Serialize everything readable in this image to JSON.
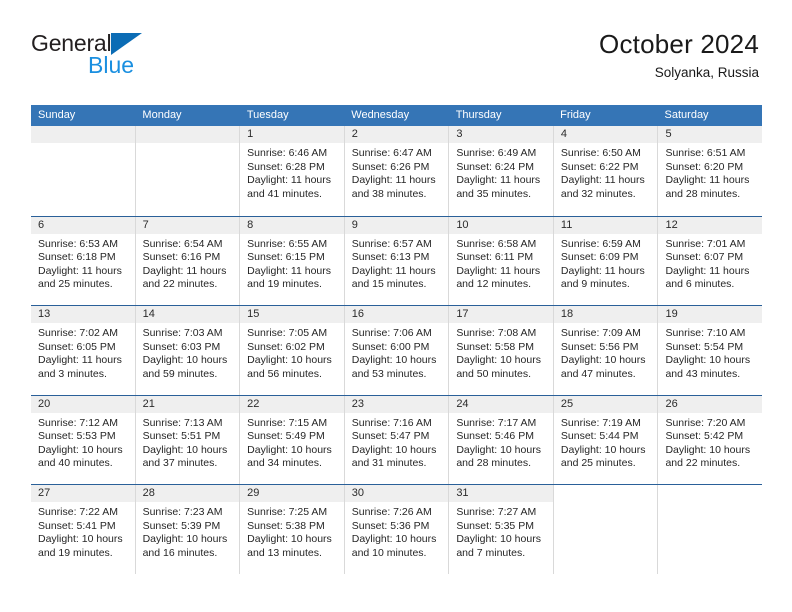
{
  "brand": {
    "name_part1": "General",
    "name_part2": "Blue",
    "logo_icon": "triangle-logo-icon"
  },
  "header": {
    "title": "October 2024",
    "location": "Solyanka, Russia"
  },
  "colors": {
    "header_blue": "#3575b6",
    "week_divider_blue": "#2a6099",
    "daynum_band": "#efefef",
    "brand_blue": "#1a8fe0",
    "logo_blue": "#0b6cb5"
  },
  "weekdays": [
    "Sunday",
    "Monday",
    "Tuesday",
    "Wednesday",
    "Thursday",
    "Friday",
    "Saturday"
  ],
  "weeks": [
    {
      "days": [
        {
          "num": "",
          "sunrise": "",
          "sunset": "",
          "daylight1": "",
          "daylight2": "",
          "empty": true
        },
        {
          "num": "",
          "sunrise": "",
          "sunset": "",
          "daylight1": "",
          "daylight2": "",
          "empty": true
        },
        {
          "num": "1",
          "sunrise": "Sunrise: 6:46 AM",
          "sunset": "Sunset: 6:28 PM",
          "daylight1": "Daylight: 11 hours",
          "daylight2": "and 41 minutes."
        },
        {
          "num": "2",
          "sunrise": "Sunrise: 6:47 AM",
          "sunset": "Sunset: 6:26 PM",
          "daylight1": "Daylight: 11 hours",
          "daylight2": "and 38 minutes."
        },
        {
          "num": "3",
          "sunrise": "Sunrise: 6:49 AM",
          "sunset": "Sunset: 6:24 PM",
          "daylight1": "Daylight: 11 hours",
          "daylight2": "and 35 minutes."
        },
        {
          "num": "4",
          "sunrise": "Sunrise: 6:50 AM",
          "sunset": "Sunset: 6:22 PM",
          "daylight1": "Daylight: 11 hours",
          "daylight2": "and 32 minutes."
        },
        {
          "num": "5",
          "sunrise": "Sunrise: 6:51 AM",
          "sunset": "Sunset: 6:20 PM",
          "daylight1": "Daylight: 11 hours",
          "daylight2": "and 28 minutes."
        }
      ]
    },
    {
      "days": [
        {
          "num": "6",
          "sunrise": "Sunrise: 6:53 AM",
          "sunset": "Sunset: 6:18 PM",
          "daylight1": "Daylight: 11 hours",
          "daylight2": "and 25 minutes."
        },
        {
          "num": "7",
          "sunrise": "Sunrise: 6:54 AM",
          "sunset": "Sunset: 6:16 PM",
          "daylight1": "Daylight: 11 hours",
          "daylight2": "and 22 minutes."
        },
        {
          "num": "8",
          "sunrise": "Sunrise: 6:55 AM",
          "sunset": "Sunset: 6:15 PM",
          "daylight1": "Daylight: 11 hours",
          "daylight2": "and 19 minutes."
        },
        {
          "num": "9",
          "sunrise": "Sunrise: 6:57 AM",
          "sunset": "Sunset: 6:13 PM",
          "daylight1": "Daylight: 11 hours",
          "daylight2": "and 15 minutes."
        },
        {
          "num": "10",
          "sunrise": "Sunrise: 6:58 AM",
          "sunset": "Sunset: 6:11 PM",
          "daylight1": "Daylight: 11 hours",
          "daylight2": "and 12 minutes."
        },
        {
          "num": "11",
          "sunrise": "Sunrise: 6:59 AM",
          "sunset": "Sunset: 6:09 PM",
          "daylight1": "Daylight: 11 hours",
          "daylight2": "and 9 minutes."
        },
        {
          "num": "12",
          "sunrise": "Sunrise: 7:01 AM",
          "sunset": "Sunset: 6:07 PM",
          "daylight1": "Daylight: 11 hours",
          "daylight2": "and 6 minutes."
        }
      ]
    },
    {
      "days": [
        {
          "num": "13",
          "sunrise": "Sunrise: 7:02 AM",
          "sunset": "Sunset: 6:05 PM",
          "daylight1": "Daylight: 11 hours",
          "daylight2": "and 3 minutes."
        },
        {
          "num": "14",
          "sunrise": "Sunrise: 7:03 AM",
          "sunset": "Sunset: 6:03 PM",
          "daylight1": "Daylight: 10 hours",
          "daylight2": "and 59 minutes."
        },
        {
          "num": "15",
          "sunrise": "Sunrise: 7:05 AM",
          "sunset": "Sunset: 6:02 PM",
          "daylight1": "Daylight: 10 hours",
          "daylight2": "and 56 minutes."
        },
        {
          "num": "16",
          "sunrise": "Sunrise: 7:06 AM",
          "sunset": "Sunset: 6:00 PM",
          "daylight1": "Daylight: 10 hours",
          "daylight2": "and 53 minutes."
        },
        {
          "num": "17",
          "sunrise": "Sunrise: 7:08 AM",
          "sunset": "Sunset: 5:58 PM",
          "daylight1": "Daylight: 10 hours",
          "daylight2": "and 50 minutes."
        },
        {
          "num": "18",
          "sunrise": "Sunrise: 7:09 AM",
          "sunset": "Sunset: 5:56 PM",
          "daylight1": "Daylight: 10 hours",
          "daylight2": "and 47 minutes."
        },
        {
          "num": "19",
          "sunrise": "Sunrise: 7:10 AM",
          "sunset": "Sunset: 5:54 PM",
          "daylight1": "Daylight: 10 hours",
          "daylight2": "and 43 minutes."
        }
      ]
    },
    {
      "days": [
        {
          "num": "20",
          "sunrise": "Sunrise: 7:12 AM",
          "sunset": "Sunset: 5:53 PM",
          "daylight1": "Daylight: 10 hours",
          "daylight2": "and 40 minutes."
        },
        {
          "num": "21",
          "sunrise": "Sunrise: 7:13 AM",
          "sunset": "Sunset: 5:51 PM",
          "daylight1": "Daylight: 10 hours",
          "daylight2": "and 37 minutes."
        },
        {
          "num": "22",
          "sunrise": "Sunrise: 7:15 AM",
          "sunset": "Sunset: 5:49 PM",
          "daylight1": "Daylight: 10 hours",
          "daylight2": "and 34 minutes."
        },
        {
          "num": "23",
          "sunrise": "Sunrise: 7:16 AM",
          "sunset": "Sunset: 5:47 PM",
          "daylight1": "Daylight: 10 hours",
          "daylight2": "and 31 minutes."
        },
        {
          "num": "24",
          "sunrise": "Sunrise: 7:17 AM",
          "sunset": "Sunset: 5:46 PM",
          "daylight1": "Daylight: 10 hours",
          "daylight2": "and 28 minutes."
        },
        {
          "num": "25",
          "sunrise": "Sunrise: 7:19 AM",
          "sunset": "Sunset: 5:44 PM",
          "daylight1": "Daylight: 10 hours",
          "daylight2": "and 25 minutes."
        },
        {
          "num": "26",
          "sunrise": "Sunrise: 7:20 AM",
          "sunset": "Sunset: 5:42 PM",
          "daylight1": "Daylight: 10 hours",
          "daylight2": "and 22 minutes."
        }
      ]
    },
    {
      "days": [
        {
          "num": "27",
          "sunrise": "Sunrise: 7:22 AM",
          "sunset": "Sunset: 5:41 PM",
          "daylight1": "Daylight: 10 hours",
          "daylight2": "and 19 minutes."
        },
        {
          "num": "28",
          "sunrise": "Sunrise: 7:23 AM",
          "sunset": "Sunset: 5:39 PM",
          "daylight1": "Daylight: 10 hours",
          "daylight2": "and 16 minutes."
        },
        {
          "num": "29",
          "sunrise": "Sunrise: 7:25 AM",
          "sunset": "Sunset: 5:38 PM",
          "daylight1": "Daylight: 10 hours",
          "daylight2": "and 13 minutes."
        },
        {
          "num": "30",
          "sunrise": "Sunrise: 7:26 AM",
          "sunset": "Sunset: 5:36 PM",
          "daylight1": "Daylight: 10 hours",
          "daylight2": "and 10 minutes."
        },
        {
          "num": "31",
          "sunrise": "Sunrise: 7:27 AM",
          "sunset": "Sunset: 5:35 PM",
          "daylight1": "Daylight: 10 hours",
          "daylight2": "and 7 minutes."
        },
        {
          "num": "",
          "sunrise": "",
          "sunset": "",
          "daylight1": "",
          "daylight2": "",
          "empty": true,
          "noband": true
        },
        {
          "num": "",
          "sunrise": "",
          "sunset": "",
          "daylight1": "",
          "daylight2": "",
          "empty": true,
          "noband": true
        }
      ]
    }
  ]
}
